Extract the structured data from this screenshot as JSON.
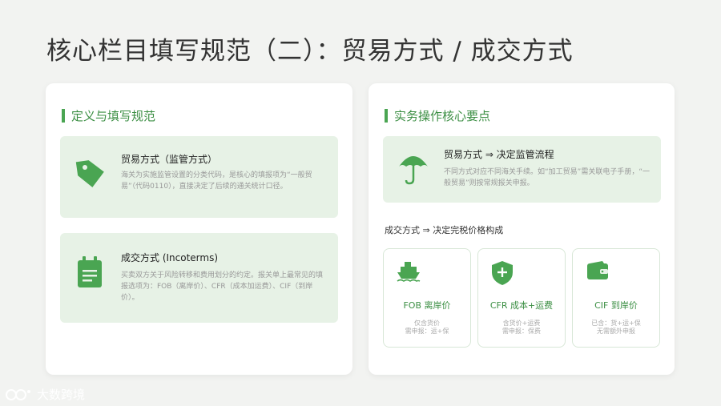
{
  "page": {
    "title": "核心栏目填写规范（二）：贸易方式 / 成交方式"
  },
  "left": {
    "section_title": "定义与填写规范",
    "box1": {
      "title": "贸易方式（监管方式）",
      "desc": "海关为实施监管设置的分类代码，是核心的填报项为“一般贸易”（代码0110），直接决定了后续的通关统计口径。"
    },
    "box2": {
      "title": "成交方式 (Incoterms)",
      "desc": "买卖双方关于风险转移和费用划分的约定。报关单上最常见的填报选项为：FOB（离岸价）、CFR（成本加运费）、CIF（到岸价）。"
    }
  },
  "right": {
    "section_title": "实务操作核心要点",
    "box": {
      "title": "贸易方式 ⇒ 决定监管流程",
      "desc": "不同方式对应不同海关手续。如“加工贸易”需关联电子手册，“一般贸易”则按常规报关申报。"
    },
    "sub_title": "成交方式 ⇒ 决定完税价格构成",
    "cards": [
      {
        "icon": "ship-icon",
        "title": "FOB 离岸价",
        "desc": "仅含货价\n需申报：运+保"
      },
      {
        "icon": "shield-plus-icon",
        "title": "CFR 成本+运费",
        "desc": "含货价+运费\n需申报：保费"
      },
      {
        "icon": "wallet-icon",
        "title": "CIF 到岸价",
        "desc": "已含：货+运+保\n无需额外申报"
      }
    ]
  },
  "watermark": {
    "text": "大数跨境"
  },
  "colors": {
    "accent": "#4aa552",
    "panel": "#e7f2e6",
    "background": "#f2f3f1"
  }
}
